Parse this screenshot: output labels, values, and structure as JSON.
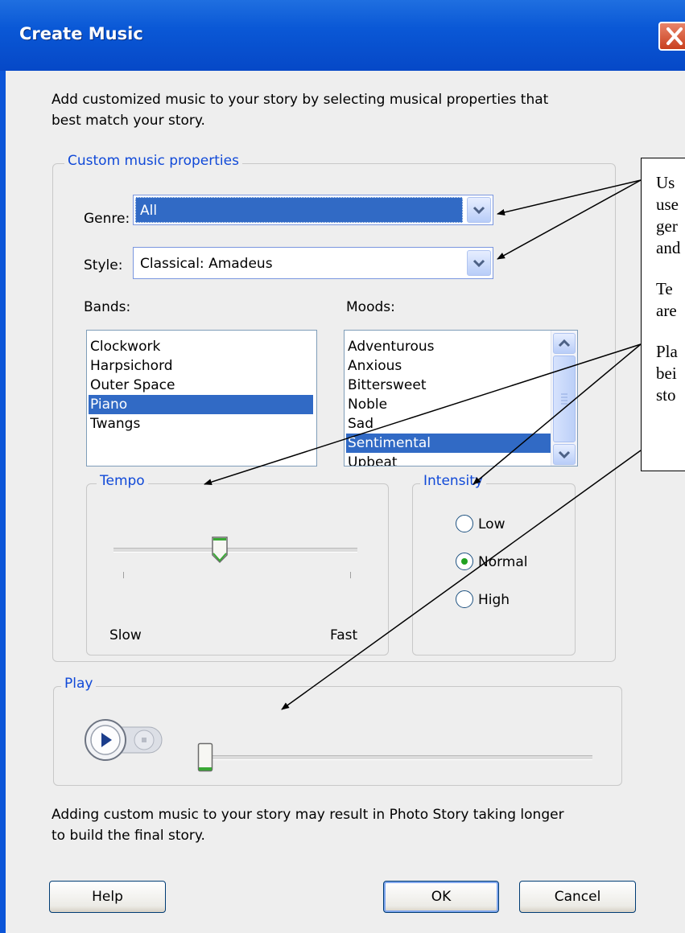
{
  "window": {
    "title": "Create Music",
    "title_bar_color": "#0a58d6"
  },
  "intro_text": [
    "Add customized music to your story by selecting musical properties that",
    "best match your story."
  ],
  "custom_properties": {
    "legend": "Custom music properties",
    "genre": {
      "label": "Genre:",
      "value": "All"
    },
    "style": {
      "label": "Style:",
      "value": "Classical: Amadeus"
    },
    "bands": {
      "label": "Bands:",
      "items": [
        "Clockwork",
        "Harpsichord",
        "Outer Space",
        "Piano",
        "Twangs"
      ],
      "selected": "Piano"
    },
    "moods": {
      "label": "Moods:",
      "items": [
        "Adventurous",
        "Anxious",
        "Bittersweet",
        "Noble",
        "Sad",
        "Sentimental",
        "Upbeat"
      ],
      "selected": "Sentimental"
    },
    "tempo": {
      "legend": "Tempo",
      "min_label": "Slow",
      "max_label": "Fast",
      "value_fraction": 0.43
    },
    "intensity": {
      "legend": "Intensity",
      "options": [
        "Low",
        "Normal",
        "High"
      ],
      "selected": "Normal"
    }
  },
  "play": {
    "legend": "Play",
    "position_fraction": 0.0
  },
  "footer_text": [
    "Adding custom music to your story may result in Photo Story taking longer",
    "to build the final story."
  ],
  "buttons": {
    "help": "Help",
    "ok": "OK",
    "cancel": "Cancel"
  },
  "callout": {
    "lines": [
      "Us",
      "use",
      "ger",
      "and",
      "",
      "Te",
      "are",
      "",
      "Pla",
      "bei",
      "sto"
    ]
  },
  "colors": {
    "accent_blue": "#1049d8",
    "selection": "#316ac5",
    "radio_dot": "#21a121",
    "slider_thumb": "#3aa835"
  }
}
